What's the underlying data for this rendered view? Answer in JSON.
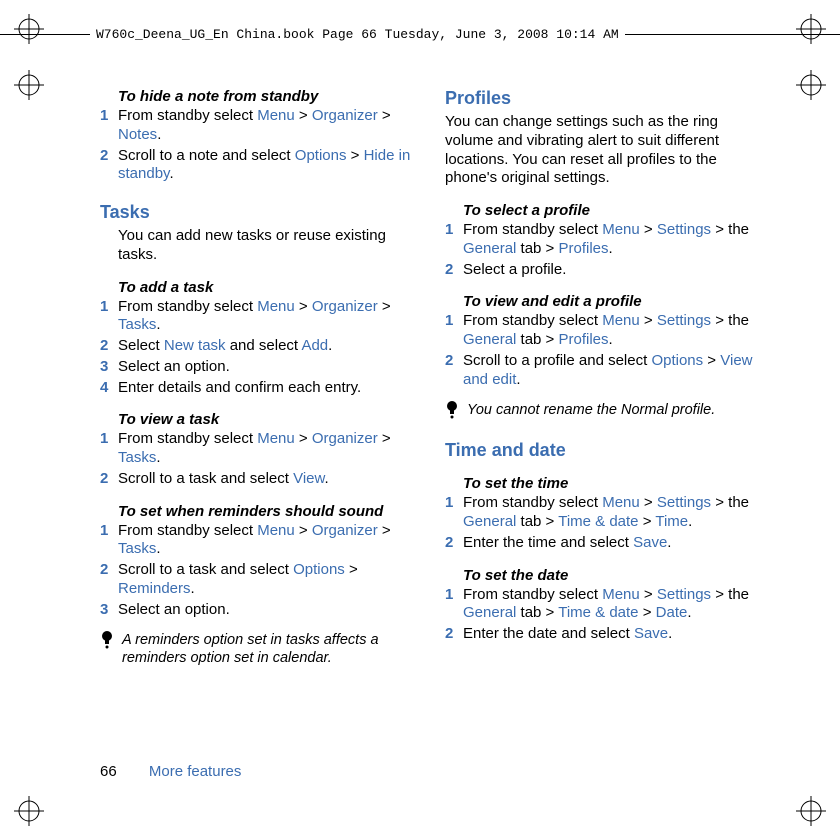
{
  "header": "W760c_Deena_UG_En China.book  Page 66  Tuesday, June 3, 2008  10:14 AM",
  "left": {
    "hideNote": {
      "title": "To hide a note from standby",
      "i1_a": "From standby select ",
      "i1_menu": "Menu",
      "i1_gt1": " > ",
      "i1_org": "Organizer",
      "i1_gt2": " > ",
      "i1_notes": "Notes",
      "i1_dot": ".",
      "i2_a": "Scroll to a note and select ",
      "i2_opt": "Options",
      "i2_gt": " > ",
      "i2_hide": "Hide in standby",
      "i2_dot": "."
    },
    "tasksHead": "Tasks",
    "tasksIntro": "You can add new tasks or reuse existing tasks.",
    "addTask": {
      "title": "To add a task",
      "i1_a": "From standby select ",
      "i1_menu": "Menu",
      "i1_gt1": " > ",
      "i1_org": "Organizer",
      "i1_gt2": " > ",
      "i1_tasks": "Tasks",
      "i1_dot": ".",
      "i2_a": "Select ",
      "i2_new": "New task",
      "i2_b": " and select ",
      "i2_add": "Add",
      "i2_dot": ".",
      "i3": "Select an option.",
      "i4": "Enter details and confirm each entry."
    },
    "viewTask": {
      "title": "To view a task",
      "i1_a": "From standby select ",
      "i1_menu": "Menu",
      "i1_gt1": " > ",
      "i1_org": "Organizer",
      "i1_gt2": " > ",
      "i1_tasks": "Tasks",
      "i1_dot": ".",
      "i2_a": "Scroll to a task and select ",
      "i2_view": "View",
      "i2_dot": "."
    },
    "reminders": {
      "title": "To set when reminders should sound",
      "i1_a": "From standby select ",
      "i1_menu": "Menu",
      "i1_gt1": " > ",
      "i1_org": "Organizer",
      "i1_gt2": " > ",
      "i1_tasks": "Tasks",
      "i1_dot": ".",
      "i2_a": "Scroll to a task and select ",
      "i2_opt": "Options",
      "i2_gt": " > ",
      "i2_rem": "Reminders",
      "i2_dot": ".",
      "i3": "Select an option."
    },
    "note": "A reminders option set in tasks affects a reminders option set in calendar."
  },
  "right": {
    "profilesHead": "Profiles",
    "profilesIntro": "You can change settings such as the ring volume and vibrating alert to suit different locations. You can reset all profiles to the phone's original settings.",
    "selectProfile": {
      "title": "To select a profile",
      "i1_a": "From standby select ",
      "i1_menu": "Menu",
      "i1_gt1": " > ",
      "i1_set": "Settings",
      "i1_gt2": " > the ",
      "i1_gen": "General",
      "i1_b": " tab > ",
      "i1_prof": "Profiles",
      "i1_dot": ".",
      "i2": "Select a profile."
    },
    "viewEdit": {
      "title": "To view and edit a profile",
      "i1_a": "From standby select ",
      "i1_menu": "Menu",
      "i1_gt1": " > ",
      "i1_set": "Settings",
      "i1_gt2": " > the ",
      "i1_gen": "General",
      "i1_b": " tab > ",
      "i1_prof": "Profiles",
      "i1_dot": ".",
      "i2_a": "Scroll to a profile and select ",
      "i2_opt": "Options",
      "i2_gt": " > ",
      "i2_ve": "View and edit",
      "i2_dot": "."
    },
    "note": "You cannot rename the Normal profile.",
    "timeHead": "Time and date",
    "setTime": {
      "title": "To set the time",
      "i1_a": "From standby select ",
      "i1_menu": "Menu",
      "i1_gt1": " > ",
      "i1_set": "Settings",
      "i1_gt2": " > the ",
      "i1_gen": "General",
      "i1_b": " tab > ",
      "i1_td": "Time & date",
      "i1_gt3": " > ",
      "i1_time": "Time",
      "i1_dot": ".",
      "i2_a": "Enter the time and select ",
      "i2_save": "Save",
      "i2_dot": "."
    },
    "setDate": {
      "title": "To set the date",
      "i1_a": "From standby select ",
      "i1_menu": "Menu",
      "i1_gt1": " > ",
      "i1_set": "Settings",
      "i1_gt2": " > the ",
      "i1_gen": "General",
      "i1_b": " tab > ",
      "i1_td": "Time & date",
      "i1_gt3": " > ",
      "i1_date": "Date",
      "i1_dot": ".",
      "i2_a": "Enter the date and select ",
      "i2_save": "Save",
      "i2_dot": "."
    }
  },
  "footer": {
    "page": "66",
    "section": "More features"
  }
}
